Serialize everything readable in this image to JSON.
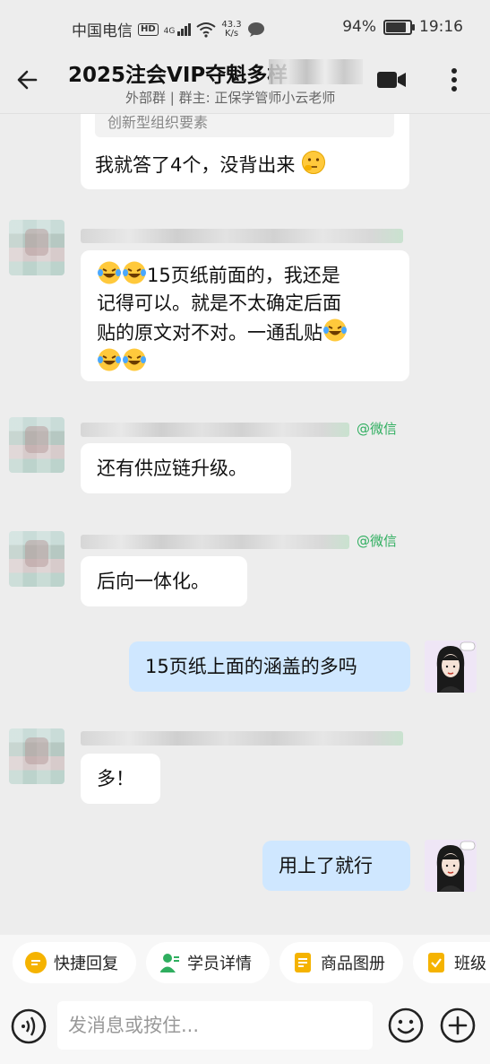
{
  "status_bar": {
    "carrier": "中国电信",
    "hd": "HD",
    "network": "4G",
    "speed_value": "43.3",
    "speed_unit": "K/s",
    "battery": "94%",
    "time": "19:16"
  },
  "header": {
    "title": "2025注会VIP夺魁多样",
    "subtitle": "外部群 | 群主: 正保学管师小云老师"
  },
  "messages": {
    "quote_text": "创新型组织要素",
    "m1": "我就答了4个，没背出来",
    "m2_line1": "15页纸前面的，我还是",
    "m2_line2": "记得可以。就是不太确定后面",
    "m2_line3": "贴的原文对不对。一通乱贴",
    "m3": "还有供应链升级。",
    "m4": "后向一体化。",
    "m5": "15页纸上面的涵盖的多吗",
    "m6": "多！",
    "m7": "用上了就行",
    "wx_tag": "@微信"
  },
  "quick_actions": [
    {
      "label": "快捷回复",
      "color": "#f5b300"
    },
    {
      "label": "学员详情",
      "color": "#2fae5f"
    },
    {
      "label": "商品图册",
      "color": "#f5b300"
    },
    {
      "label": "班级",
      "color": "#f5b300"
    }
  ],
  "input": {
    "placeholder": "发消息或按住..."
  }
}
